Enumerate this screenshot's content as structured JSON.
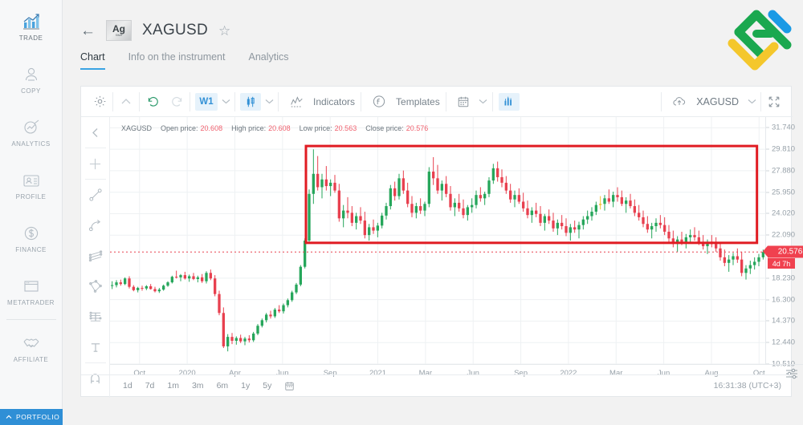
{
  "sidebar": {
    "items": [
      {
        "label": "TRADE",
        "icon": "chart-bars-icon",
        "active": true
      },
      {
        "label": "COPY",
        "icon": "person-copy-icon",
        "active": false
      },
      {
        "label": "ANALYTICS",
        "icon": "analytics-magnifier-icon",
        "active": false
      },
      {
        "label": "PROFILE",
        "icon": "id-card-icon",
        "active": false
      },
      {
        "label": "FINANCE",
        "icon": "dollar-circle-icon",
        "active": false
      },
      {
        "label": "METATRADER",
        "icon": "window-icon",
        "active": false
      },
      {
        "label": "AFFILIATE",
        "icon": "handshake-icon",
        "active": false
      }
    ],
    "portfolio_label": "PORTFOLIO",
    "portfolio_icon": "chevron-up-icon",
    "portfolio_color": "#2f8fd6"
  },
  "header": {
    "back_icon": "arrow-left-icon",
    "instrument_badge_symbol": "Ag",
    "instrument_badge_name": "Silver",
    "symbol": "XAGUSD",
    "favorite_icon": "star-outline-icon",
    "tabs": [
      {
        "label": "Chart",
        "active": true
      },
      {
        "label": "Info on the instrument",
        "active": false
      },
      {
        "label": "Analytics",
        "active": false
      }
    ],
    "logo_name": "litefinance-logo"
  },
  "toolbar": {
    "settings_icon": "gear-icon",
    "collapse_icon": "chevron-up-icon",
    "undo_icon": "undo-icon",
    "redo_icon": "redo-icon",
    "timeframe": "W1",
    "timeframe_chevron": "chevron-down-icon",
    "charttype_icon": "candlestick-icon",
    "charttype_chevron": "chevron-down-icon",
    "indicators_icon": "indicator-line-icon",
    "indicators_label": "Indicators",
    "templates_icon": "function-fx-icon",
    "templates_label": "Templates",
    "calendar_icon": "calendar-icon",
    "calendar_chevron": "chevron-down-icon",
    "volumes_icon": "bar-chart-icon",
    "upload_icon": "cloud-upload-icon",
    "chart_symbol": "XAGUSD",
    "symbol_chevron": "chevron-down-icon",
    "fullscreen_icon": "fullscreen-icon",
    "accent_color": "#3391d6",
    "accent_bg": "#e6f2fb"
  },
  "drawing_rail": [
    {
      "icon": "chevron-left-icon",
      "name": "collapse-rail"
    },
    {
      "icon": "crosshair-icon",
      "name": "crosshair-tool"
    },
    {
      "icon": "trendline-icon",
      "name": "trendline-tool"
    },
    {
      "icon": "curve-arc-icon",
      "name": "curve-tool"
    },
    {
      "icon": "parallel-channel-icon",
      "name": "channel-tool"
    },
    {
      "icon": "polygon-shape-icon",
      "name": "shape-tool"
    },
    {
      "icon": "fibonacci-icon",
      "name": "fibonacci-tool"
    },
    {
      "icon": "text-tool-icon",
      "name": "text-tool"
    },
    {
      "icon": "magnet-icon",
      "name": "magnet-tool"
    }
  ],
  "ohlc": {
    "symbol": "XAGUSD",
    "open_label": "Open price:",
    "open_value": "20.608",
    "high_label": "High price:",
    "high_value": "20.608",
    "low_label": "Low price:",
    "low_value": "20.563",
    "close_label": "Close price:",
    "close_value": "20.576",
    "value_color": "#f0616e"
  },
  "price_marker": {
    "price": "20.576",
    "countdown": "4d 7h",
    "color": "#f0414f"
  },
  "range_bar": {
    "options": [
      "1d",
      "7d",
      "1m",
      "3m",
      "6m",
      "1y",
      "5y"
    ],
    "calendar_icon": "calendar-icon",
    "clock": "16:31:38 (UTC+3)"
  },
  "axis_settings_icon": "sliders-icon",
  "chart_data": {
    "type": "candlestick",
    "title": "XAGUSD",
    "timeframe": "W1",
    "xlabel": "",
    "ylabel": "",
    "grid": true,
    "ylim": [
      10.51,
      32.7
    ],
    "y_ticks": [
      "31.740",
      "29.810",
      "27.880",
      "25.950",
      "24.020",
      "22.090",
      "18.230",
      "16.300",
      "14.370",
      "12.440",
      "10.510"
    ],
    "x_ticks": [
      "Oct",
      "2020",
      "Apr",
      "Jun",
      "Sep",
      "2021",
      "Mar",
      "Jun",
      "Sep",
      "2022",
      "Mar",
      "Jun",
      "Aug",
      "Oct"
    ],
    "last_price": 20.576,
    "colors": {
      "up": "#26a65b",
      "down": "#e8404f",
      "neutral": "#f2c12e",
      "box": "#e01b22",
      "price_line": "#e8404f"
    },
    "annotation": {
      "shape": "rectangle",
      "color": "#e01b22",
      "x_from": "Aug 2020",
      "x_to": "Jun 2022",
      "y_top": 30.1,
      "y_bottom": 21.4
    },
    "candles": [
      [
        17.55,
        17.95,
        17.25,
        17.6
      ],
      [
        17.6,
        18.05,
        17.4,
        17.85
      ],
      [
        17.85,
        18.1,
        17.55,
        17.7
      ],
      [
        17.7,
        18.3,
        17.6,
        18.2
      ],
      [
        18.2,
        18.4,
        17.3,
        17.45
      ],
      [
        17.45,
        17.6,
        17.05,
        17.15
      ],
      [
        17.15,
        17.45,
        16.95,
        17.35
      ],
      [
        17.35,
        17.55,
        17.1,
        17.3
      ],
      [
        17.3,
        17.6,
        17.15,
        17.5
      ],
      [
        17.5,
        17.7,
        17.2,
        17.25
      ],
      [
        17.25,
        17.45,
        16.95,
        17.05
      ],
      [
        17.05,
        17.35,
        16.9,
        17.2
      ],
      [
        17.2,
        17.65,
        17.1,
        17.55
      ],
      [
        17.55,
        17.95,
        17.45,
        17.85
      ],
      [
        17.85,
        18.45,
        17.75,
        18.35
      ],
      [
        18.35,
        18.9,
        18.2,
        18.3
      ],
      [
        18.3,
        18.6,
        17.95,
        18.5
      ],
      [
        18.5,
        18.8,
        18.1,
        18.2
      ],
      [
        18.2,
        18.55,
        17.9,
        18.4
      ],
      [
        18.4,
        18.7,
        18.05,
        18.15
      ],
      [
        18.15,
        18.45,
        17.85,
        18.3
      ],
      [
        18.3,
        18.6,
        17.8,
        17.95
      ],
      [
        17.95,
        18.85,
        17.75,
        18.7
      ],
      [
        18.7,
        19.0,
        18.05,
        18.2
      ],
      [
        18.2,
        18.5,
        16.6,
        16.8
      ],
      [
        16.8,
        17.1,
        14.9,
        15.1
      ],
      [
        15.1,
        15.6,
        11.95,
        12.1
      ],
      [
        12.1,
        13.2,
        11.65,
        12.95
      ],
      [
        12.95,
        13.3,
        12.3,
        12.6
      ],
      [
        12.6,
        13.0,
        12.25,
        12.85
      ],
      [
        12.85,
        13.15,
        12.4,
        12.55
      ],
      [
        12.55,
        12.95,
        12.2,
        12.8
      ],
      [
        12.8,
        13.1,
        12.45,
        12.65
      ],
      [
        12.65,
        13.4,
        12.5,
        13.25
      ],
      [
        13.25,
        14.1,
        13.1,
        13.95
      ],
      [
        13.95,
        14.6,
        13.8,
        14.45
      ],
      [
        14.45,
        15.1,
        14.25,
        14.95
      ],
      [
        14.95,
        15.3,
        14.6,
        14.8
      ],
      [
        14.8,
        15.55,
        14.65,
        15.4
      ],
      [
        15.4,
        15.8,
        15.1,
        15.25
      ],
      [
        15.25,
        15.95,
        15.05,
        15.8
      ],
      [
        15.8,
        16.4,
        15.6,
        16.25
      ],
      [
        16.25,
        17.1,
        16.1,
        16.95
      ],
      [
        16.95,
        17.8,
        16.8,
        17.65
      ],
      [
        17.65,
        19.4,
        17.5,
        19.25
      ],
      [
        19.25,
        21.8,
        19.1,
        21.6
      ],
      [
        21.6,
        26.2,
        21.4,
        25.8
      ],
      [
        25.8,
        29.8,
        24.9,
        27.6
      ],
      [
        27.6,
        29.2,
        26.1,
        26.4
      ],
      [
        26.4,
        27.6,
        25.4,
        27.1
      ],
      [
        27.1,
        28.3,
        26.1,
        26.5
      ],
      [
        26.5,
        27.1,
        25.6,
        26.8
      ],
      [
        26.8,
        27.5,
        25.9,
        26.1
      ],
      [
        26.1,
        26.7,
        23.3,
        23.6
      ],
      [
        23.6,
        24.8,
        22.8,
        24.3
      ],
      [
        24.3,
        25.5,
        23.6,
        24.1
      ],
      [
        24.1,
        24.7,
        22.9,
        23.2
      ],
      [
        23.2,
        24.1,
        22.6,
        23.8
      ],
      [
        23.8,
        24.6,
        23.1,
        23.4
      ],
      [
        23.4,
        24.2,
        21.8,
        22.1
      ],
      [
        22.1,
        23.1,
        21.6,
        22.8
      ],
      [
        22.8,
        23.5,
        22.2,
        22.5
      ],
      [
        22.5,
        23.2,
        21.9,
        22.95
      ],
      [
        22.95,
        24.1,
        22.7,
        23.85
      ],
      [
        23.85,
        25.0,
        23.5,
        24.7
      ],
      [
        24.7,
        26.6,
        24.4,
        26.3
      ],
      [
        26.3,
        26.9,
        25.2,
        25.6
      ],
      [
        25.6,
        27.6,
        25.3,
        27.2
      ],
      [
        27.2,
        27.9,
        25.8,
        26.1
      ],
      [
        26.1,
        26.8,
        24.6,
        24.9
      ],
      [
        24.9,
        25.6,
        23.7,
        24.1
      ],
      [
        24.1,
        25.0,
        23.6,
        24.7
      ],
      [
        24.7,
        25.4,
        24.0,
        24.3
      ],
      [
        24.3,
        25.1,
        23.8,
        24.9
      ],
      [
        24.9,
        28.2,
        24.6,
        27.8
      ],
      [
        27.8,
        29.1,
        26.6,
        27.2
      ],
      [
        27.2,
        28.4,
        25.8,
        26.1
      ],
      [
        26.1,
        27.0,
        25.2,
        26.7
      ],
      [
        26.7,
        27.4,
        25.5,
        25.8
      ],
      [
        25.8,
        26.5,
        24.3,
        24.6
      ],
      [
        24.6,
        25.4,
        23.8,
        25.0
      ],
      [
        25.0,
        25.8,
        24.2,
        24.5
      ],
      [
        24.5,
        25.3,
        23.6,
        23.9
      ],
      [
        23.9,
        24.8,
        23.4,
        24.6
      ],
      [
        24.6,
        25.4,
        24.1,
        24.8
      ],
      [
        24.8,
        26.1,
        24.5,
        25.7
      ],
      [
        25.7,
        26.4,
        25.1,
        25.4
      ],
      [
        25.4,
        26.0,
        24.8,
        25.8
      ],
      [
        25.8,
        27.3,
        25.5,
        27.0
      ],
      [
        27.0,
        28.5,
        26.7,
        28.1
      ],
      [
        28.1,
        28.7,
        26.9,
        27.3
      ],
      [
        27.3,
        28.0,
        26.4,
        26.8
      ],
      [
        26.8,
        27.4,
        25.8,
        26.1
      ],
      [
        26.1,
        26.7,
        25.0,
        25.3
      ],
      [
        25.3,
        26.1,
        24.6,
        25.7
      ],
      [
        25.7,
        26.3,
        24.9,
        25.1
      ],
      [
        25.1,
        25.9,
        24.2,
        24.5
      ],
      [
        24.5,
        25.2,
        23.6,
        23.9
      ],
      [
        23.9,
        24.6,
        23.2,
        24.3
      ],
      [
        24.3,
        25.0,
        23.7,
        24.0
      ],
      [
        24.0,
        24.7,
        22.9,
        23.2
      ],
      [
        23.2,
        24.0,
        22.5,
        23.8
      ],
      [
        23.8,
        24.4,
        23.1,
        23.4
      ],
      [
        23.4,
        24.1,
        22.4,
        22.7
      ],
      [
        22.7,
        23.5,
        22.1,
        23.2
      ],
      [
        23.2,
        23.9,
        22.6,
        22.9
      ],
      [
        22.9,
        23.6,
        22.0,
        22.3
      ],
      [
        22.3,
        23.1,
        21.6,
        22.8
      ],
      [
        22.8,
        23.4,
        22.3,
        22.6
      ],
      [
        22.6,
        23.3,
        21.8,
        23.0
      ],
      [
        23.0,
        23.8,
        22.6,
        23.5
      ],
      [
        23.5,
        24.3,
        23.1,
        23.8
      ],
      [
        23.8,
        24.6,
        23.4,
        24.2
      ],
      [
        24.2,
        25.1,
        23.9,
        24.8
      ],
      [
        24.8,
        25.6,
        24.4,
        24.9
      ],
      [
        24.9,
        25.7,
        24.3,
        25.4
      ],
      [
        25.4,
        26.2,
        24.9,
        25.1
      ],
      [
        25.1,
        26.0,
        24.6,
        25.7
      ],
      [
        25.7,
        26.4,
        25.1,
        25.5
      ],
      [
        25.5,
        26.1,
        24.7,
        24.9
      ],
      [
        24.9,
        25.5,
        24.1,
        25.2
      ],
      [
        25.2,
        25.8,
        24.5,
        24.7
      ],
      [
        24.7,
        25.3,
        23.8,
        24.1
      ],
      [
        24.1,
        24.8,
        23.4,
        23.7
      ],
      [
        23.7,
        24.3,
        22.8,
        23.1
      ],
      [
        23.1,
        23.8,
        22.3,
        22.6
      ],
      [
        22.6,
        23.2,
        21.8,
        22.9
      ],
      [
        22.9,
        23.6,
        22.4,
        23.2
      ],
      [
        23.2,
        23.9,
        22.7,
        23.0
      ],
      [
        23.0,
        23.7,
        22.1,
        22.4
      ],
      [
        22.4,
        23.0,
        21.5,
        21.8
      ],
      [
        21.8,
        22.5,
        21.0,
        21.3
      ],
      [
        21.3,
        22.0,
        20.6,
        21.7
      ],
      [
        21.7,
        22.4,
        21.2,
        21.5
      ],
      [
        21.5,
        22.2,
        20.9,
        21.9
      ],
      [
        21.9,
        22.6,
        21.4,
        22.1
      ],
      [
        22.1,
        22.8,
        21.6,
        21.9
      ],
      [
        21.9,
        22.5,
        21.2,
        21.4
      ],
      [
        21.4,
        22.1,
        20.8,
        21.1
      ],
      [
        21.1,
        21.7,
        20.4,
        21.5
      ],
      [
        21.5,
        22.1,
        21.0,
        21.3
      ],
      [
        21.3,
        21.9,
        20.6,
        20.9
      ],
      [
        20.9,
        21.5,
        19.8,
        20.1
      ],
      [
        20.1,
        20.8,
        19.3,
        19.6
      ],
      [
        19.6,
        20.3,
        18.8,
        19.9
      ],
      [
        19.9,
        20.5,
        19.4,
        20.2
      ],
      [
        20.2,
        20.9,
        19.6,
        19.9
      ],
      [
        19.9,
        20.6,
        18.4,
        18.7
      ],
      [
        18.7,
        19.4,
        18.1,
        19.1
      ],
      [
        19.1,
        19.8,
        18.6,
        19.4
      ],
      [
        19.4,
        20.1,
        19.0,
        19.7
      ],
      [
        19.7,
        20.4,
        19.3,
        20.1
      ],
      [
        20.1,
        20.8,
        19.9,
        20.58
      ]
    ]
  }
}
